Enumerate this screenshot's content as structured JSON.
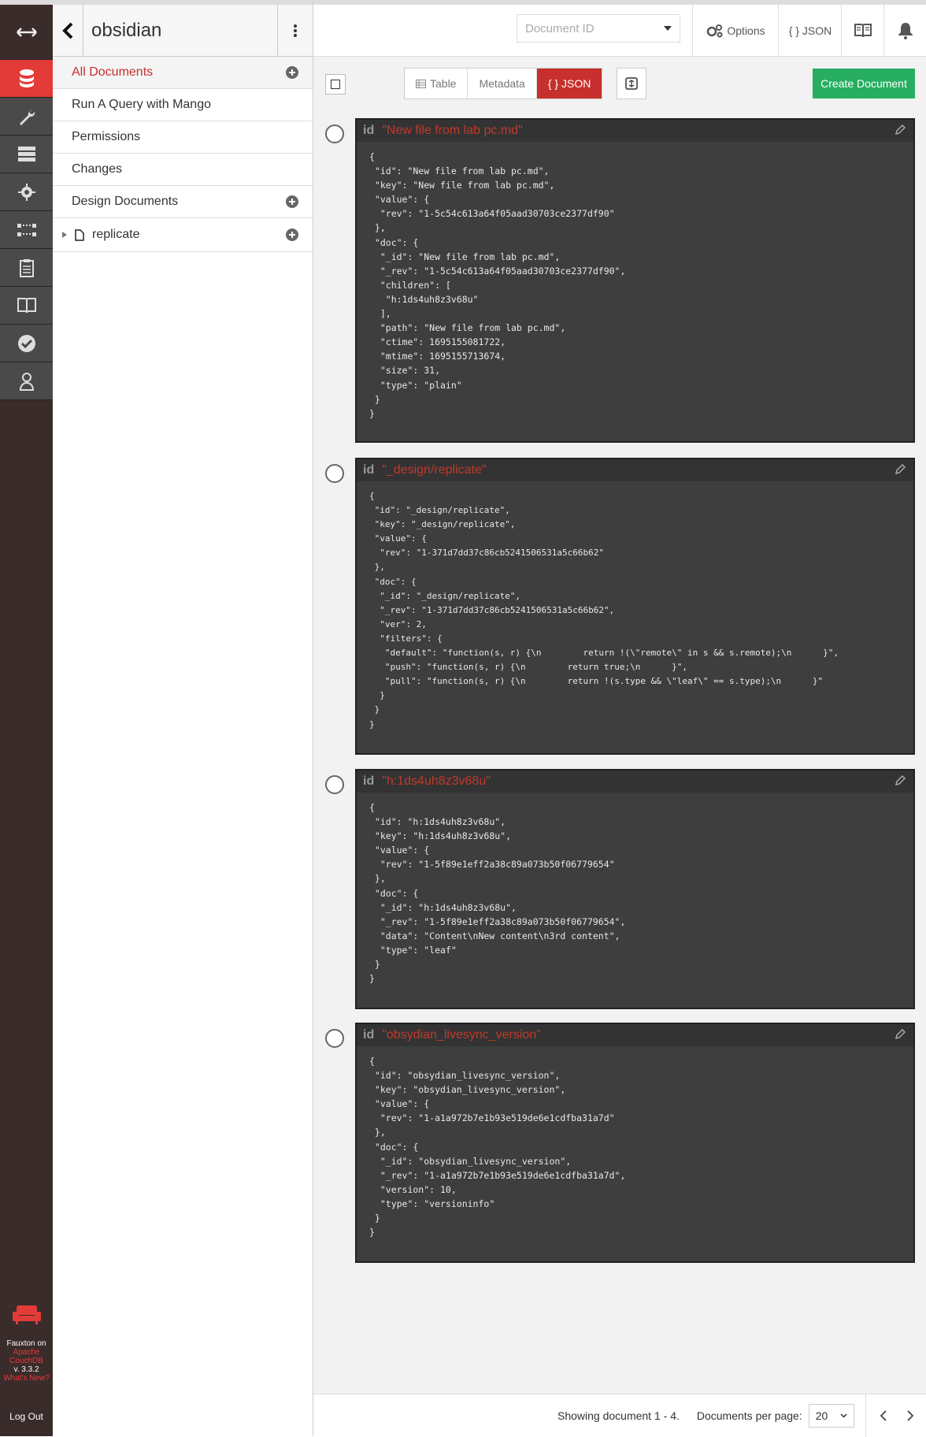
{
  "rail": {
    "footer_app": "Fauxton on",
    "footer_link1": "Apache",
    "footer_link2": "CouchDB",
    "footer_version": "v. 3.3.2",
    "footer_whatsnew": "What's New?",
    "logout": "Log Out"
  },
  "sidebar": {
    "title": "obsidian",
    "items": [
      {
        "label": "All Documents"
      },
      {
        "label": "Run A Query with Mango"
      },
      {
        "label": "Permissions"
      },
      {
        "label": "Changes"
      },
      {
        "label": "Design Documents"
      },
      {
        "label": "replicate"
      }
    ]
  },
  "topbar": {
    "docid_placeholder": "Document ID",
    "options": "Options",
    "json": "{ } JSON"
  },
  "toolbar": {
    "table": "Table",
    "metadata": "Metadata",
    "json": "{ } JSON",
    "create": "Create Document"
  },
  "docs": [
    {
      "id_label": "id",
      "id": "\"New file from lab pc.md\"",
      "json": "{\n \"id\": \"New file from lab pc.md\",\n \"key\": \"New file from lab pc.md\",\n \"value\": {\n  \"rev\": \"1-5c54c613a64f05aad30703ce2377df90\"\n },\n \"doc\": {\n  \"_id\": \"New file from lab pc.md\",\n  \"_rev\": \"1-5c54c613a64f05aad30703ce2377df90\",\n  \"children\": [\n   \"h:1ds4uh8z3v68u\"\n  ],\n  \"path\": \"New file from lab pc.md\",\n  \"ctime\": 1695155081722,\n  \"mtime\": 1695155713674,\n  \"size\": 31,\n  \"type\": \"plain\"\n }\n}"
    },
    {
      "id_label": "id",
      "id": "\"_design/replicate\"",
      "json": "{\n \"id\": \"_design/replicate\",\n \"key\": \"_design/replicate\",\n \"value\": {\n  \"rev\": \"1-371d7dd37c86cb5241506531a5c66b62\"\n },\n \"doc\": {\n  \"_id\": \"_design/replicate\",\n  \"_rev\": \"1-371d7dd37c86cb5241506531a5c66b62\",\n  \"ver\": 2,\n  \"filters\": {\n   \"default\": \"function(s, r) {\\n        return !(\\\"remote\\\" in s && s.remote);\\n      }\",\n   \"push\": \"function(s, r) {\\n        return true;\\n      }\",\n   \"pull\": \"function(s, r) {\\n        return !(s.type && \\\"leaf\\\" == s.type);\\n      }\"\n  }\n }\n}"
    },
    {
      "id_label": "id",
      "id": "\"h:1ds4uh8z3v68u\"",
      "json": "{\n \"id\": \"h:1ds4uh8z3v68u\",\n \"key\": \"h:1ds4uh8z3v68u\",\n \"value\": {\n  \"rev\": \"1-5f89e1eff2a38c89a073b50f06779654\"\n },\n \"doc\": {\n  \"_id\": \"h:1ds4uh8z3v68u\",\n  \"_rev\": \"1-5f89e1eff2a38c89a073b50f06779654\",\n  \"data\": \"Content\\nNew content\\n3rd content\",\n  \"type\": \"leaf\"\n }\n}"
    },
    {
      "id_label": "id",
      "id": "\"obsydian_livesync_version\"",
      "json": "{\n \"id\": \"obsydian_livesync_version\",\n \"key\": \"obsydian_livesync_version\",\n \"value\": {\n  \"rev\": \"1-a1a972b7e1b93e519de6e1cdfba31a7d\"\n },\n \"doc\": {\n  \"_id\": \"obsydian_livesync_version\",\n  \"_rev\": \"1-a1a972b7e1b93e519de6e1cdfba31a7d\",\n  \"version\": 10,\n  \"type\": \"versioninfo\"\n }\n}"
    }
  ],
  "footer": {
    "showing": "Showing document 1 - 4.",
    "per_page_label": "Documents per page:",
    "per_page_value": "20"
  }
}
